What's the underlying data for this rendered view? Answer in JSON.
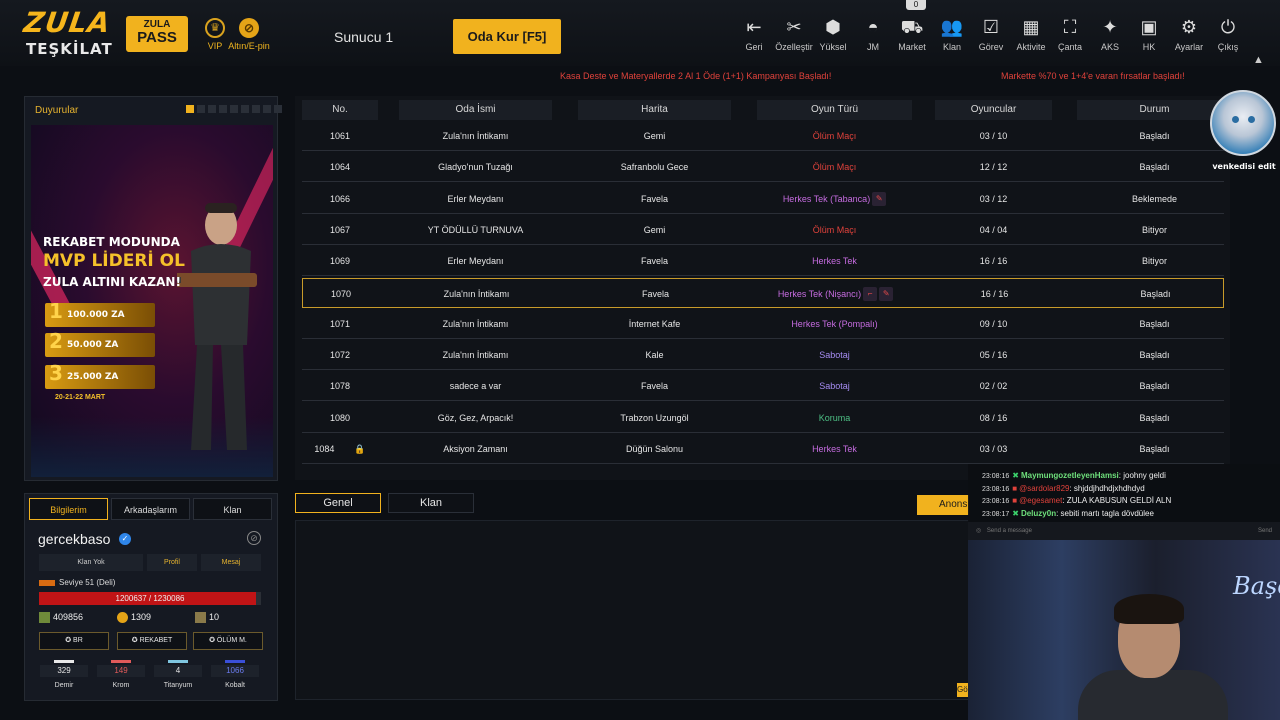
{
  "topbar": {
    "logo_line1": "ZULA",
    "logo_line2": "TEŞKİLAT",
    "pass_line1": "ZULA",
    "pass_line2": "PASS",
    "vip_label": "VIP",
    "altin_label": "Altın/E-pin",
    "server_label": "Sunucu 1",
    "create_room_label": "Oda Kur [F5]",
    "notif_count": "0",
    "nav": [
      {
        "label": "Geri",
        "icon": "back-icon"
      },
      {
        "label": "Özelleştir",
        "icon": "tools-icon"
      },
      {
        "label": "Yüksel",
        "icon": "upgrade-icon"
      },
      {
        "label": "JM",
        "icon": "jm-icon"
      },
      {
        "label": "Market",
        "icon": "cart-icon"
      },
      {
        "label": "Klan",
        "icon": "clan-icon"
      },
      {
        "label": "Görev",
        "icon": "task-icon"
      },
      {
        "label": "Aktivite",
        "icon": "activity-icon"
      },
      {
        "label": "Çanta",
        "icon": "bag-icon"
      },
      {
        "label": "AKS",
        "icon": "aks-icon"
      },
      {
        "label": "HK",
        "icon": "hk-icon"
      },
      {
        "label": "Ayarlar",
        "icon": "gear-icon"
      },
      {
        "label": "Çıkış",
        "icon": "power-icon"
      }
    ]
  },
  "tickers": {
    "left": "Kasa Deste ve Materyallerde 2 Al 1 Öde (1+1) Kampanyası Başladı!",
    "right": "Markette %70 ve 1+4'e varan fırsatlar başladı!"
  },
  "announcements": {
    "title": "Duyurular",
    "banner": {
      "line1": "REKABET MODUNDA",
      "line2": "MVP LİDERİ OL",
      "line3": "ZULA ALTINI KAZAN!",
      "prizes": [
        {
          "rank": "1",
          "amount": "100.000 ZA"
        },
        {
          "rank": "2",
          "amount": "50.000 ZA"
        },
        {
          "rank": "3",
          "amount": "25.000 ZA"
        }
      ],
      "date": "20-21-22 MART"
    }
  },
  "table": {
    "headers": [
      "No.",
      "Oda İsmi",
      "Harita",
      "Oyun Türü",
      "Oyuncular",
      "Durum"
    ],
    "rows": [
      {
        "no": "1061",
        "name": "Zula'nın İntikamı",
        "map": "Gemi",
        "mode": "Ölüm Maçı",
        "players": "03 / 10",
        "status": "Başladı"
      },
      {
        "no": "1064",
        "name": "Gladyo'nun Tuzağı",
        "map": "Safranbolu Gece",
        "mode": "Ölüm Maçı",
        "players": "12 / 12",
        "status": "Başladı"
      },
      {
        "no": "1066",
        "name": "Erler Meydanı",
        "map": "Favela",
        "mode": "Herkes Tek (Tabanca)",
        "players": "03 / 12",
        "status": "Beklemede"
      },
      {
        "no": "1067",
        "name": "YT ÖDÜLLÜ TURNUVA",
        "map": "Gemi",
        "mode": "Ölüm Maçı",
        "players": "04 / 04",
        "status": "Bitiyor"
      },
      {
        "no": "1069",
        "name": "Erler Meydanı",
        "map": "Favela",
        "mode": "Herkes Tek",
        "players": "16 / 16",
        "status": "Bitiyor"
      },
      {
        "no": "1070",
        "name": "Zula'nın İntikamı",
        "map": "Favela",
        "mode": "Herkes Tek (Nişancı)",
        "players": "16 / 16",
        "status": "Başladı"
      },
      {
        "no": "1071",
        "name": "Zula'nın İntikamı",
        "map": "İnternet Kafe",
        "mode": "Herkes Tek (Pompalı)",
        "players": "09 / 10",
        "status": "Başladı"
      },
      {
        "no": "1072",
        "name": "Zula'nın İntikamı",
        "map": "Kale",
        "mode": "Sabotaj",
        "players": "05 / 16",
        "status": "Başladı"
      },
      {
        "no": "1078",
        "name": "sadece a var",
        "map": "Favela",
        "mode": "Sabotaj",
        "players": "02 / 02",
        "status": "Başladı"
      },
      {
        "no": "1080",
        "name": "Göz, Gez, Arpacık!",
        "map": "Trabzon Uzungöl",
        "mode": "Koruma",
        "players": "08 / 16",
        "status": "Başladı"
      },
      {
        "no": "1084",
        "name": "Aksiyon Zamanı",
        "map": "Düğün Salonu",
        "mode": "Herkes Tek",
        "players": "03 / 03",
        "status": "Başladı"
      }
    ]
  },
  "profile": {
    "tabs": [
      "Bilgilerim",
      "Arkadaşlarım",
      "Klan"
    ],
    "username": "gercekbaso",
    "clan_status": "Klan Yok",
    "profile_btn": "Profil",
    "message_btn": "Mesaj",
    "level": "Seviye 51 (Deli)",
    "xp_text": "1200637 / 1230086",
    "xp_fraction": 0.976,
    "currency1": "409856",
    "currency2": "1309",
    "currency3": "10",
    "ranks": [
      "BR",
      "REKABET",
      "ÖLÜM M."
    ],
    "materials": [
      {
        "label": "Demir",
        "value": "329",
        "color": "#e8e8e8"
      },
      {
        "label": "Krom",
        "value": "149",
        "color": "#e05a5a"
      },
      {
        "label": "Titanyum",
        "value": "4",
        "color": "#7fc6e0"
      },
      {
        "label": "Kobalt",
        "value": "1066",
        "color": "#3a4fd8"
      }
    ]
  },
  "chat": {
    "tabs": [
      "Genel",
      "Klan"
    ],
    "announce_btn": "Anons",
    "send_btn": "Gö"
  },
  "overlay": {
    "avatar_name": "venkedisi edit",
    "messages": [
      {
        "time": "23:08:16",
        "user": "MaymungozetleyenHamsi",
        "text": ": joohny geldi",
        "ok": true
      },
      {
        "time": "23:08:16",
        "user": "@sardolar829",
        "text": ": shjddjhdhdjxhdhdyd",
        "ok": false
      },
      {
        "time": "23:08:16",
        "user": "@egesamet",
        "text": ": ZULA KABUSUN GELDİ ALN",
        "ok": false
      },
      {
        "time": "23:08:17",
        "user": "Deluzy0n",
        "text": ": sebiti martı tagla dövdülee",
        "ok": true
      }
    ],
    "input_placeholder": "Send a message",
    "send_label": "Send",
    "neon_text": "Başo"
  }
}
